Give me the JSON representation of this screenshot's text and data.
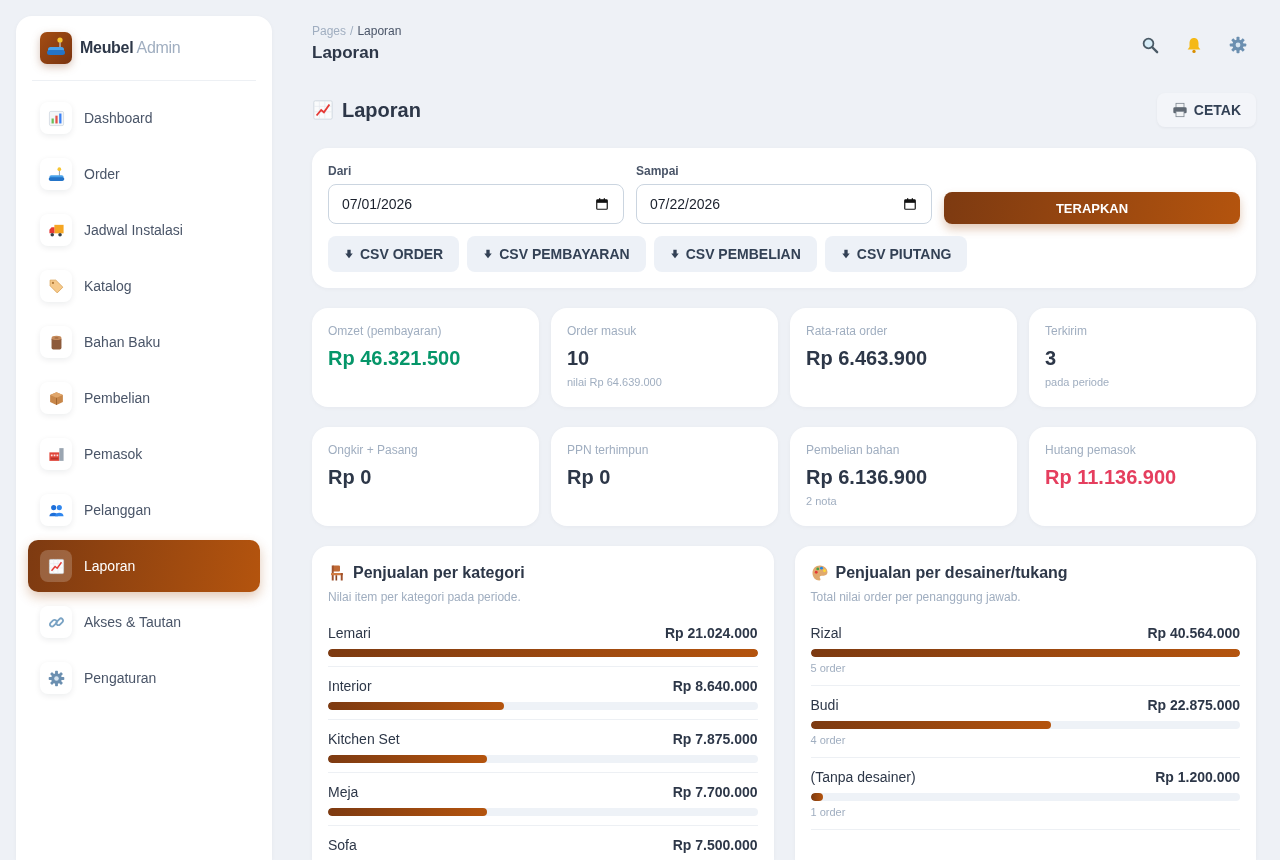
{
  "sidebar": {
    "brand": {
      "name": "Meubel",
      "suffix": "Admin"
    },
    "items": [
      {
        "label": "Dashboard",
        "selected": false
      },
      {
        "label": "Order",
        "selected": false
      },
      {
        "label": "Jadwal Instalasi",
        "selected": false
      },
      {
        "label": "Katalog",
        "selected": false
      },
      {
        "label": "Bahan Baku",
        "selected": false
      },
      {
        "label": "Pembelian",
        "selected": false
      },
      {
        "label": "Pemasok",
        "selected": false
      },
      {
        "label": "Pelanggan",
        "selected": false
      },
      {
        "label": "Laporan",
        "selected": true
      },
      {
        "label": "Akses & Tautan",
        "selected": false
      },
      {
        "label": "Pengaturan",
        "selected": false
      }
    ]
  },
  "header": {
    "breadcrumb": [
      "Pages",
      "Laporan"
    ],
    "separator": "/",
    "title": "Laporan"
  },
  "page": {
    "title": "Laporan",
    "print_button": "CETAK"
  },
  "filter": {
    "fields": [
      {
        "label": "Dari",
        "value": "07/01/2026"
      },
      {
        "label": "Sampai",
        "value": "07/22/2026"
      }
    ],
    "apply_button": "TERAPKAN",
    "exports": [
      "CSV ORDER",
      "CSV PEMBAYARAN",
      "CSV PEMBELIAN",
      "CSV PIUTANG"
    ]
  },
  "stats": [
    {
      "label": "Omzet (pembayaran)",
      "value": "Rp 46.321.500",
      "color": "#059669"
    },
    {
      "label": "Order masuk",
      "value": "10",
      "note": "nilai Rp 64.639.000",
      "color": "#2d3748"
    },
    {
      "label": "Rata-rata order",
      "value": "Rp 6.463.900",
      "color": "#2d3748"
    },
    {
      "label": "Terkirim",
      "value": "3",
      "note": "pada periode",
      "color": "#2d3748"
    },
    {
      "label": "Ongkir + Pasang",
      "value": "Rp 0",
      "color": "#2d3748"
    },
    {
      "label": "PPN terhimpun",
      "value": "Rp 0",
      "color": "#2d3748"
    },
    {
      "label": "Pembelian bahan",
      "value": "Rp 6.136.900",
      "note": "2 nota",
      "color": "#2d3748"
    },
    {
      "label": "Hutang pemasok",
      "value": "Rp 11.136.900",
      "color": "#e53e5e"
    }
  ],
  "panels": [
    {
      "title": "Penjualan per kategori",
      "subtitle": "Nilai item per kategori pada periode.",
      "rows": [
        {
          "name": "Lemari",
          "amount": "Rp 21.024.000",
          "level": 1
        },
        {
          "name": "Interior",
          "amount": "Rp 8.640.000",
          "level": 0.41
        },
        {
          "name": "Kitchen Set",
          "amount": "Rp 7.875.000",
          "level": 0.37
        },
        {
          "name": "Meja",
          "amount": "Rp 7.700.000",
          "level": 0.37
        },
        {
          "name": "Sofa",
          "amount": "Rp 7.500.000"
        }
      ]
    },
    {
      "title": "Penjualan per desainer/tukang",
      "subtitle": "Total nilai order per penanggung jawab.",
      "rows": [
        {
          "name": "Rizal",
          "amount": "Rp 40.564.000",
          "level": 1,
          "note": "5 order"
        },
        {
          "name": "Budi",
          "amount": "Rp 22.875.000",
          "level": 0.56,
          "note": "4 order"
        },
        {
          "name": "(Tanpa desainer)",
          "amount": "Rp 1.200.000",
          "level": 0.03,
          "note": "1 order"
        }
      ]
    }
  ]
}
